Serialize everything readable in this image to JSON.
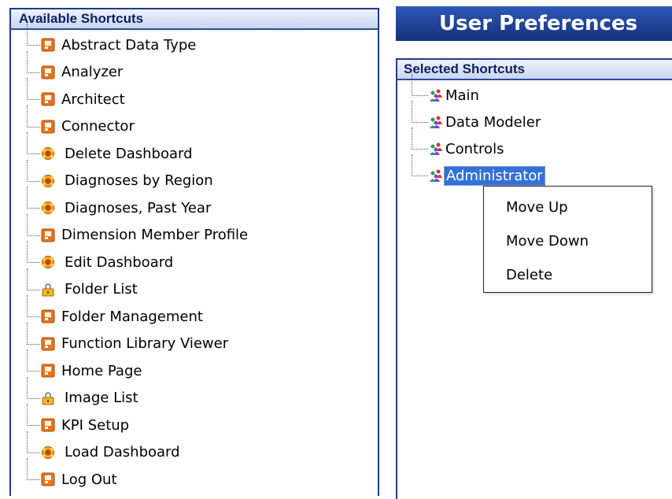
{
  "title": "User Preferences",
  "available": {
    "header": "Available Shortcuts",
    "items": [
      {
        "label": "Abstract Data Type",
        "icon": "app-tile-icon"
      },
      {
        "label": "Analyzer",
        "icon": "app-tile-icon"
      },
      {
        "label": "Architect",
        "icon": "app-tile-icon"
      },
      {
        "label": "Connector",
        "icon": "app-tile-icon"
      },
      {
        "label": "Delete Dashboard",
        "icon": "dashboard-gear-icon"
      },
      {
        "label": "Diagnoses by Region",
        "icon": "dashboard-gear-icon"
      },
      {
        "label": "Diagnoses, Past Year",
        "icon": "dashboard-gear-icon"
      },
      {
        "label": "Dimension Member Profile",
        "icon": "app-tile-icon"
      },
      {
        "label": "Edit Dashboard",
        "icon": "dashboard-gear-icon"
      },
      {
        "label": "Folder List",
        "icon": "folder-lock-icon"
      },
      {
        "label": "Folder Management",
        "icon": "app-tile-icon"
      },
      {
        "label": "Function Library Viewer",
        "icon": "app-tile-icon"
      },
      {
        "label": "Home Page",
        "icon": "app-tile-icon"
      },
      {
        "label": "Image List",
        "icon": "folder-lock-icon"
      },
      {
        "label": "KPI Setup",
        "icon": "app-tile-icon"
      },
      {
        "label": "Load Dashboard",
        "icon": "dashboard-gear-icon"
      },
      {
        "label": "Log Out",
        "icon": "app-tile-icon"
      }
    ]
  },
  "selected": {
    "header": "Selected Shortcuts",
    "items": [
      {
        "label": "Main",
        "icon": "users-group-icon"
      },
      {
        "label": "Data Modeler",
        "icon": "users-group-icon"
      },
      {
        "label": "Controls",
        "icon": "users-group-icon"
      },
      {
        "label": "Administrator",
        "icon": "users-group-icon",
        "selected": true
      }
    ]
  },
  "context_menu": {
    "items": [
      "Move Up",
      "Move Down",
      "Delete"
    ]
  },
  "colors": {
    "header_bg": "#c9d6f2",
    "title_bar": "#15307a",
    "selection": "#3570d6",
    "tile_orange": "#e8741a"
  }
}
